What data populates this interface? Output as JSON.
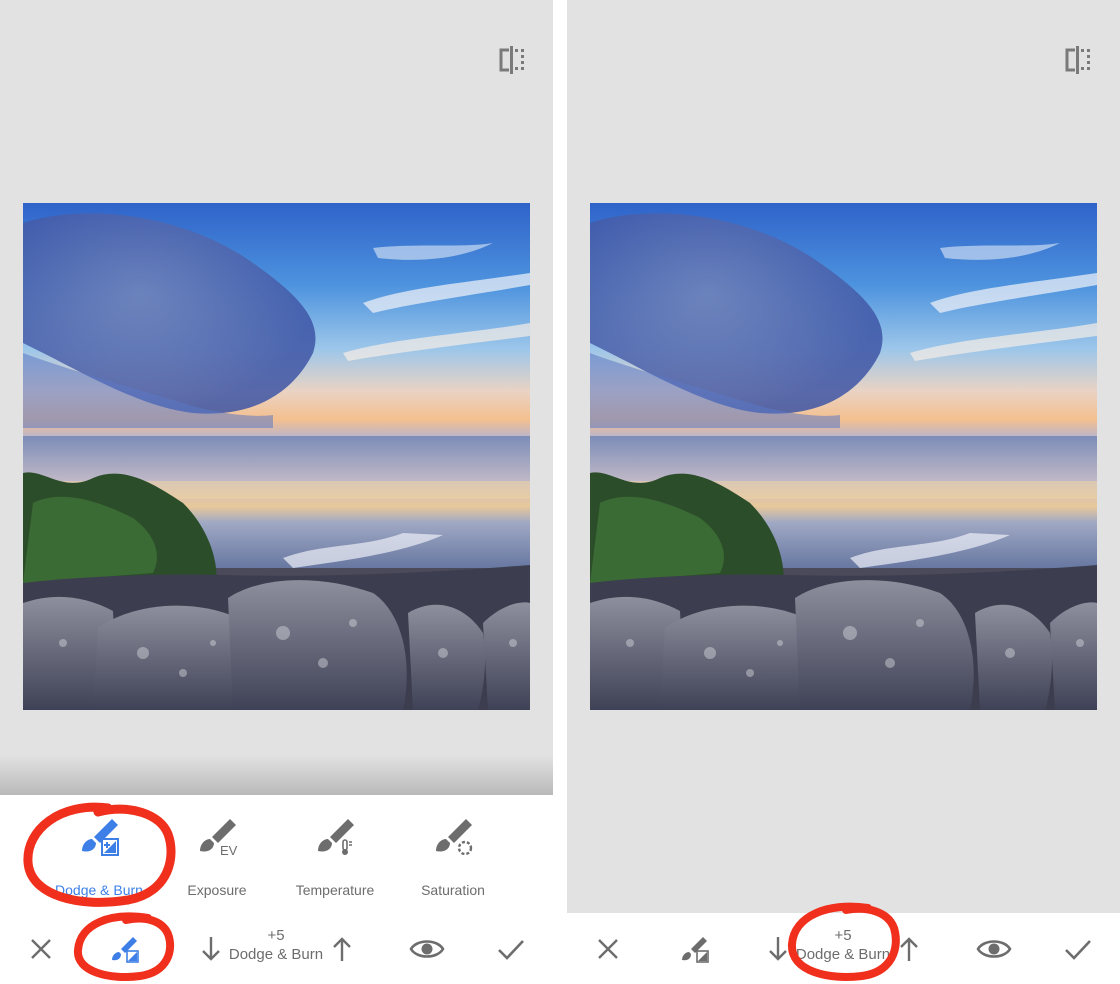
{
  "left_screen": {
    "compare_icon": "split-compare-icon",
    "brushes": [
      {
        "label": "Dodge & Burn",
        "icon": "brush-dodge-burn-icon",
        "active": true
      },
      {
        "label": "Exposure",
        "icon": "brush-exposure-icon",
        "glyph": "EV"
      },
      {
        "label": "Temperature",
        "icon": "brush-temperature-icon"
      },
      {
        "label": "Saturation",
        "icon": "brush-saturation-icon"
      }
    ],
    "bottom_bar": {
      "cancel_icon": "close-icon",
      "brush_icon": "brush-dodge-burn-icon",
      "decrease_icon": "arrow-down-icon",
      "value": "+5",
      "tool_name": "Dodge & Burn",
      "increase_icon": "arrow-up-icon",
      "view_mask_icon": "eye-icon",
      "apply_icon": "check-icon"
    }
  },
  "right_screen": {
    "compare_icon": "split-compare-icon",
    "bottom_bar": {
      "cancel_icon": "close-icon",
      "brush_icon": "brush-dodge-burn-icon",
      "decrease_icon": "arrow-down-icon",
      "value": "+5",
      "tool_name": "Dodge & Burn",
      "increase_icon": "arrow-up-icon",
      "view_mask_icon": "eye-icon",
      "apply_icon": "check-icon"
    }
  },
  "colors": {
    "background": "#e2e2e2",
    "accent": "#3d7fe6",
    "icon_gray": "#6d6d6d",
    "annotation_red": "#f0301c"
  }
}
